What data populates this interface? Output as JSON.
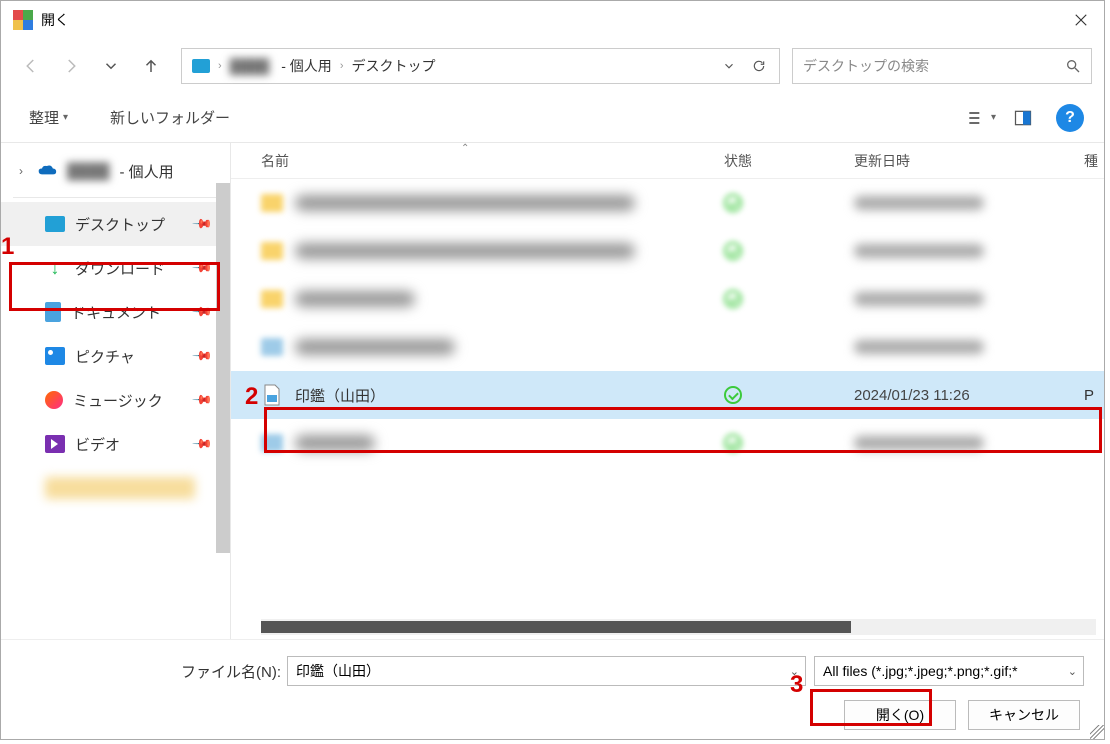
{
  "annotations": {
    "n1": "1",
    "n2": "2",
    "n3": "3"
  },
  "titlebar": {
    "title": "開く"
  },
  "nav": {
    "address": {
      "blurred_user": "　　　",
      "personal_suffix": "- 個人用",
      "folder": "デスクトップ"
    },
    "search_placeholder": "デスクトップの検索"
  },
  "toolbar": {
    "organize": "整理",
    "new_folder": "新しいフォルダー"
  },
  "columns": {
    "name": "名前",
    "status": "状態",
    "modified": "更新日時",
    "type": "種"
  },
  "sidebar": {
    "onedrive_suffix": "- 個人用",
    "items": [
      {
        "label": "デスクトップ"
      },
      {
        "label": "ダウンロード"
      },
      {
        "label": "ドキュメント"
      },
      {
        "label": "ピクチャ"
      },
      {
        "label": "ミュージック"
      },
      {
        "label": "ビデオ"
      }
    ]
  },
  "files": {
    "selected": {
      "name": "印鑑（山田）",
      "date": "2024/01/23 11:26",
      "type_initial": "P"
    }
  },
  "footer": {
    "filename_label": "ファイル名(N):",
    "filename_value": "印鑑（山田）",
    "filetype": "All files (*.jpg;*.jpeg;*.png;*.gif;*",
    "open": "開く(O)",
    "cancel": "キャンセル"
  }
}
